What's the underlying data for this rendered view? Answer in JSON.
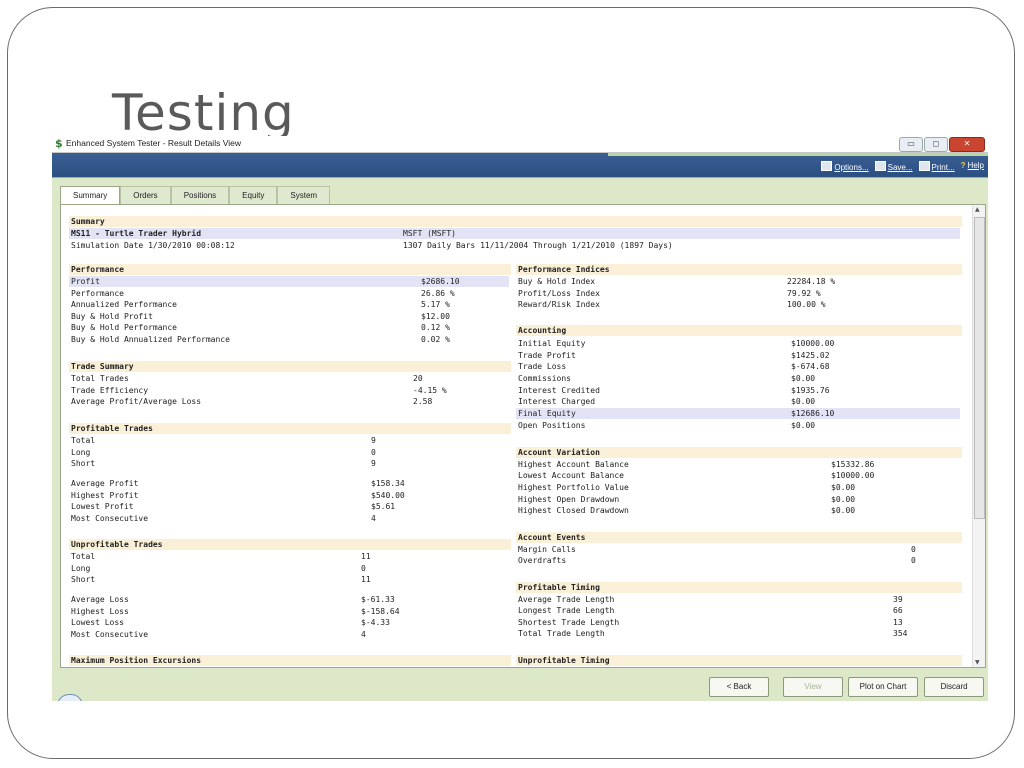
{
  "slide": {
    "title": "Testing"
  },
  "window": {
    "title": "Enhanced System Tester - Result Details View",
    "app_icon": "$"
  },
  "toolbar": {
    "options": "Options...",
    "save": "Save...",
    "print": "Print...",
    "help": "Help"
  },
  "tabs": [
    "Summary",
    "Orders",
    "Positions",
    "Equity",
    "System"
  ],
  "report": {
    "summary_header": "Summary",
    "system_name": "MS11 - Turtle Trader Hybrid",
    "symbol": "MSFT (MSFT)",
    "sim_date": "Simulation Date 1/30/2010 00:08:12",
    "bars": "1307 Daily Bars 11/11/2004 Through 1/21/2010 (1897 Days)",
    "performance": {
      "header": "Performance",
      "rows": [
        [
          "Profit",
          "$2686.10"
        ],
        [
          "Performance",
          "26.86 %"
        ],
        [
          "Annualized Performance",
          "5.17 %"
        ],
        [
          "Buy & Hold Profit",
          "$12.00"
        ],
        [
          "Buy & Hold Performance",
          "0.12 %"
        ],
        [
          "Buy & Hold Annualized Performance",
          "0.02 %"
        ]
      ]
    },
    "trade_summary": {
      "header": "Trade Summary",
      "rows": [
        [
          "Total Trades",
          "20"
        ],
        [
          "Trade Efficiency",
          "-4.15 %"
        ],
        [
          "Average Profit/Average Loss",
          "2.58"
        ]
      ]
    },
    "profitable_trades": {
      "header": "Profitable Trades",
      "rows": [
        [
          "Total",
          "9"
        ],
        [
          "Long",
          "0"
        ],
        [
          "Short",
          "9"
        ],
        [
          "Average Profit",
          "$158.34"
        ],
        [
          "Highest Profit",
          "$540.00"
        ],
        [
          "Lowest Profit",
          "$5.61"
        ],
        [
          "Most Consecutive",
          "4"
        ]
      ]
    },
    "unprofitable_trades": {
      "header": "Unprofitable Trades",
      "rows": [
        [
          "Total",
          "11"
        ],
        [
          "Long",
          "0"
        ],
        [
          "Short",
          "11"
        ],
        [
          "Average Loss",
          "$-61.33"
        ],
        [
          "Highest Loss",
          "$-158.64"
        ],
        [
          "Lowest Loss",
          "$-4.33"
        ],
        [
          "Most Consecutive",
          "4"
        ]
      ]
    },
    "max_position_excursions": {
      "header": "Maximum Position Excursions"
    },
    "performance_indices": {
      "header": "Performance Indices",
      "rows": [
        [
          "Buy & Hold Index",
          "22284.18 %"
        ],
        [
          "Profit/Loss Index",
          "79.92 %"
        ],
        [
          "Reward/Risk Index",
          "100.00 %"
        ]
      ]
    },
    "accounting": {
      "header": "Accounting",
      "rows": [
        [
          "Initial Equity",
          "$10000.00"
        ],
        [
          "Trade Profit",
          "$1425.02"
        ],
        [
          "Trade Loss",
          "$-674.68"
        ],
        [
          "Commissions",
          "$0.00"
        ],
        [
          "Interest Credited",
          "$1935.76"
        ],
        [
          "Interest Charged",
          "$0.00"
        ],
        [
          "Final Equity",
          "$12686.10"
        ],
        [
          "Open Positions",
          "$0.00"
        ]
      ]
    },
    "account_variation": {
      "header": "Account Variation",
      "rows": [
        [
          "Highest Account Balance",
          "$15332.86"
        ],
        [
          "Lowest Account Balance",
          "$10000.00"
        ],
        [
          "Highest Portfolio Value",
          "$0.00"
        ],
        [
          "Highest Open Drawdown",
          "$0.00"
        ],
        [
          "Highest Closed Drawdown",
          "$0.00"
        ]
      ]
    },
    "account_events": {
      "header": "Account Events",
      "rows": [
        [
          "Margin Calls",
          "0"
        ],
        [
          "Overdrafts",
          "0"
        ]
      ]
    },
    "profitable_timing": {
      "header": "Profitable Timing",
      "rows": [
        [
          "Average Trade Length",
          "39"
        ],
        [
          "Longest Trade Length",
          "66"
        ],
        [
          "Shortest Trade Length",
          "13"
        ],
        [
          "Total Trade Length",
          "354"
        ]
      ]
    },
    "unprofitable_timing": {
      "header": "Unprofitable Timing"
    }
  },
  "buttons": {
    "back": "< Back",
    "view": "View",
    "plot": "Plot on Chart",
    "discard": "Discard"
  }
}
